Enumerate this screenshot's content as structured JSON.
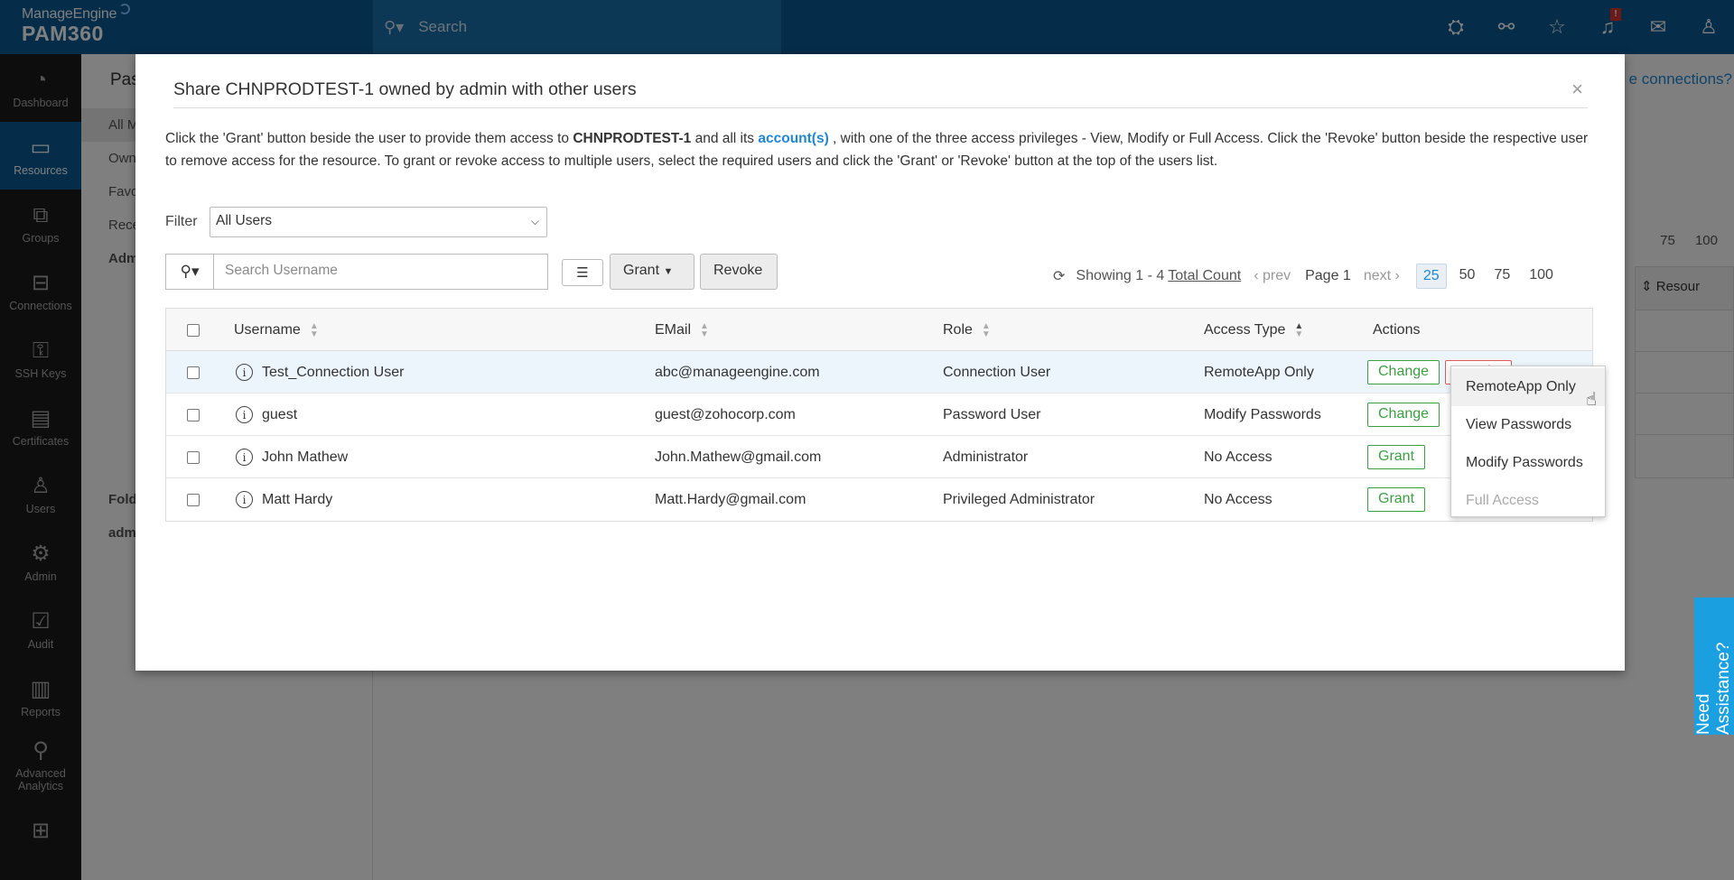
{
  "topbar": {
    "brand": "ManageEngine",
    "product": "PAM360",
    "search_placeholder": "Search",
    "icons": [
      "rocket-icon",
      "connections-icon",
      "favorites-icon",
      "bell-icon",
      "mail-icon",
      "user-icon"
    ],
    "notification_badge": "!"
  },
  "sidebar": {
    "items": [
      {
        "label": "Dashboard",
        "icon": "dashboard-icon",
        "glyph": "◔"
      },
      {
        "label": "Resources",
        "icon": "monitor-icon",
        "glyph": "▭",
        "active": true
      },
      {
        "label": "Groups",
        "icon": "groups-icon",
        "glyph": "⧉"
      },
      {
        "label": "Connections",
        "icon": "connections-icon",
        "glyph": "⊟"
      },
      {
        "label": "SSH Keys",
        "icon": "ssh-keys-icon",
        "glyph": "⚿"
      },
      {
        "label": "Certificates",
        "icon": "certificate-icon",
        "glyph": "▤"
      },
      {
        "label": "Users",
        "icon": "users-icon",
        "glyph": "♙"
      },
      {
        "label": "Admin",
        "icon": "gear-icon",
        "glyph": "⚙"
      },
      {
        "label": "Audit",
        "icon": "audit-icon",
        "glyph": "☑"
      },
      {
        "label": "Reports",
        "icon": "reports-icon",
        "glyph": "▥"
      },
      {
        "label": "Advanced Analytics",
        "icon": "analytics-icon",
        "glyph": "⚲"
      },
      {
        "label": "",
        "icon": "more-icon",
        "glyph": "⊞"
      }
    ]
  },
  "background": {
    "heading": "Pas",
    "left_items": [
      "All M",
      "Own",
      "Favo",
      "Rece",
      "Adm",
      "Fold",
      "adm"
    ],
    "link": "e connections?",
    "pager_sizes": [
      "75",
      "100"
    ],
    "col_header": "Resour"
  },
  "modal": {
    "title": "Share CHNPRODTEST-1 owned by admin with other users",
    "close": "×",
    "desc_part1": "Click the 'Grant' button beside the user to provide them access to ",
    "resource_name": "CHNPRODTEST-1",
    "desc_part2": " and all its ",
    "accounts_link": "account(s)",
    "desc_part3": " , with one of the three access privileges - View, Modify or Full Access. Click the 'Revoke' button beside the respective user to remove access for the resource. To grant or revoke access to multiple users, select the required users and click the 'Grant' or 'Revoke' button at the top of the users list.",
    "filter_label": "Filter",
    "filter_value": "All Users",
    "search_placeholder": "Search Username",
    "grant_label": "Grant",
    "revoke_label": "Revoke",
    "pager": {
      "showing": "Showing 1 - 4",
      "total": "Total Count",
      "prev": "prev",
      "page": "Page 1",
      "next": "next",
      "sizes": [
        "25",
        "50",
        "75",
        "100"
      ],
      "selected_size": "25"
    },
    "columns": {
      "username": "Username",
      "email": "EMail",
      "role": "Role",
      "access": "Access Type",
      "actions": "Actions"
    },
    "rows": [
      {
        "username": "Test_Connection User",
        "email": "abc@manageengine.com",
        "role": "Connection User",
        "access": "RemoteApp Only",
        "action": "Change",
        "action2": "Revoke"
      },
      {
        "username": "guest",
        "email": "guest@zohocorp.com",
        "role": "Password User",
        "access": "Modify Passwords",
        "action": "Change",
        "action2": ""
      },
      {
        "username": "John Mathew",
        "email": "John.Mathew@gmail.com",
        "role": "Administrator",
        "access": "No Access",
        "action": "Grant",
        "action2": ""
      },
      {
        "username": "Matt Hardy",
        "email": "Matt.Hardy@gmail.com",
        "role": "Privileged Administrator",
        "access": "No Access",
        "action": "Grant",
        "action2": ""
      }
    ],
    "dropdown": [
      "RemoteApp Only",
      "View Passwords",
      "Modify Passwords",
      "Full Access"
    ]
  },
  "assist_label": "Need Assistance?",
  "colors": {
    "topbar": "#0a5a94",
    "sidebar": "#1b1b1b",
    "accent": "#1e88d6",
    "grant_green": "#3aa040",
    "revoke_red": "#e05a5a"
  }
}
